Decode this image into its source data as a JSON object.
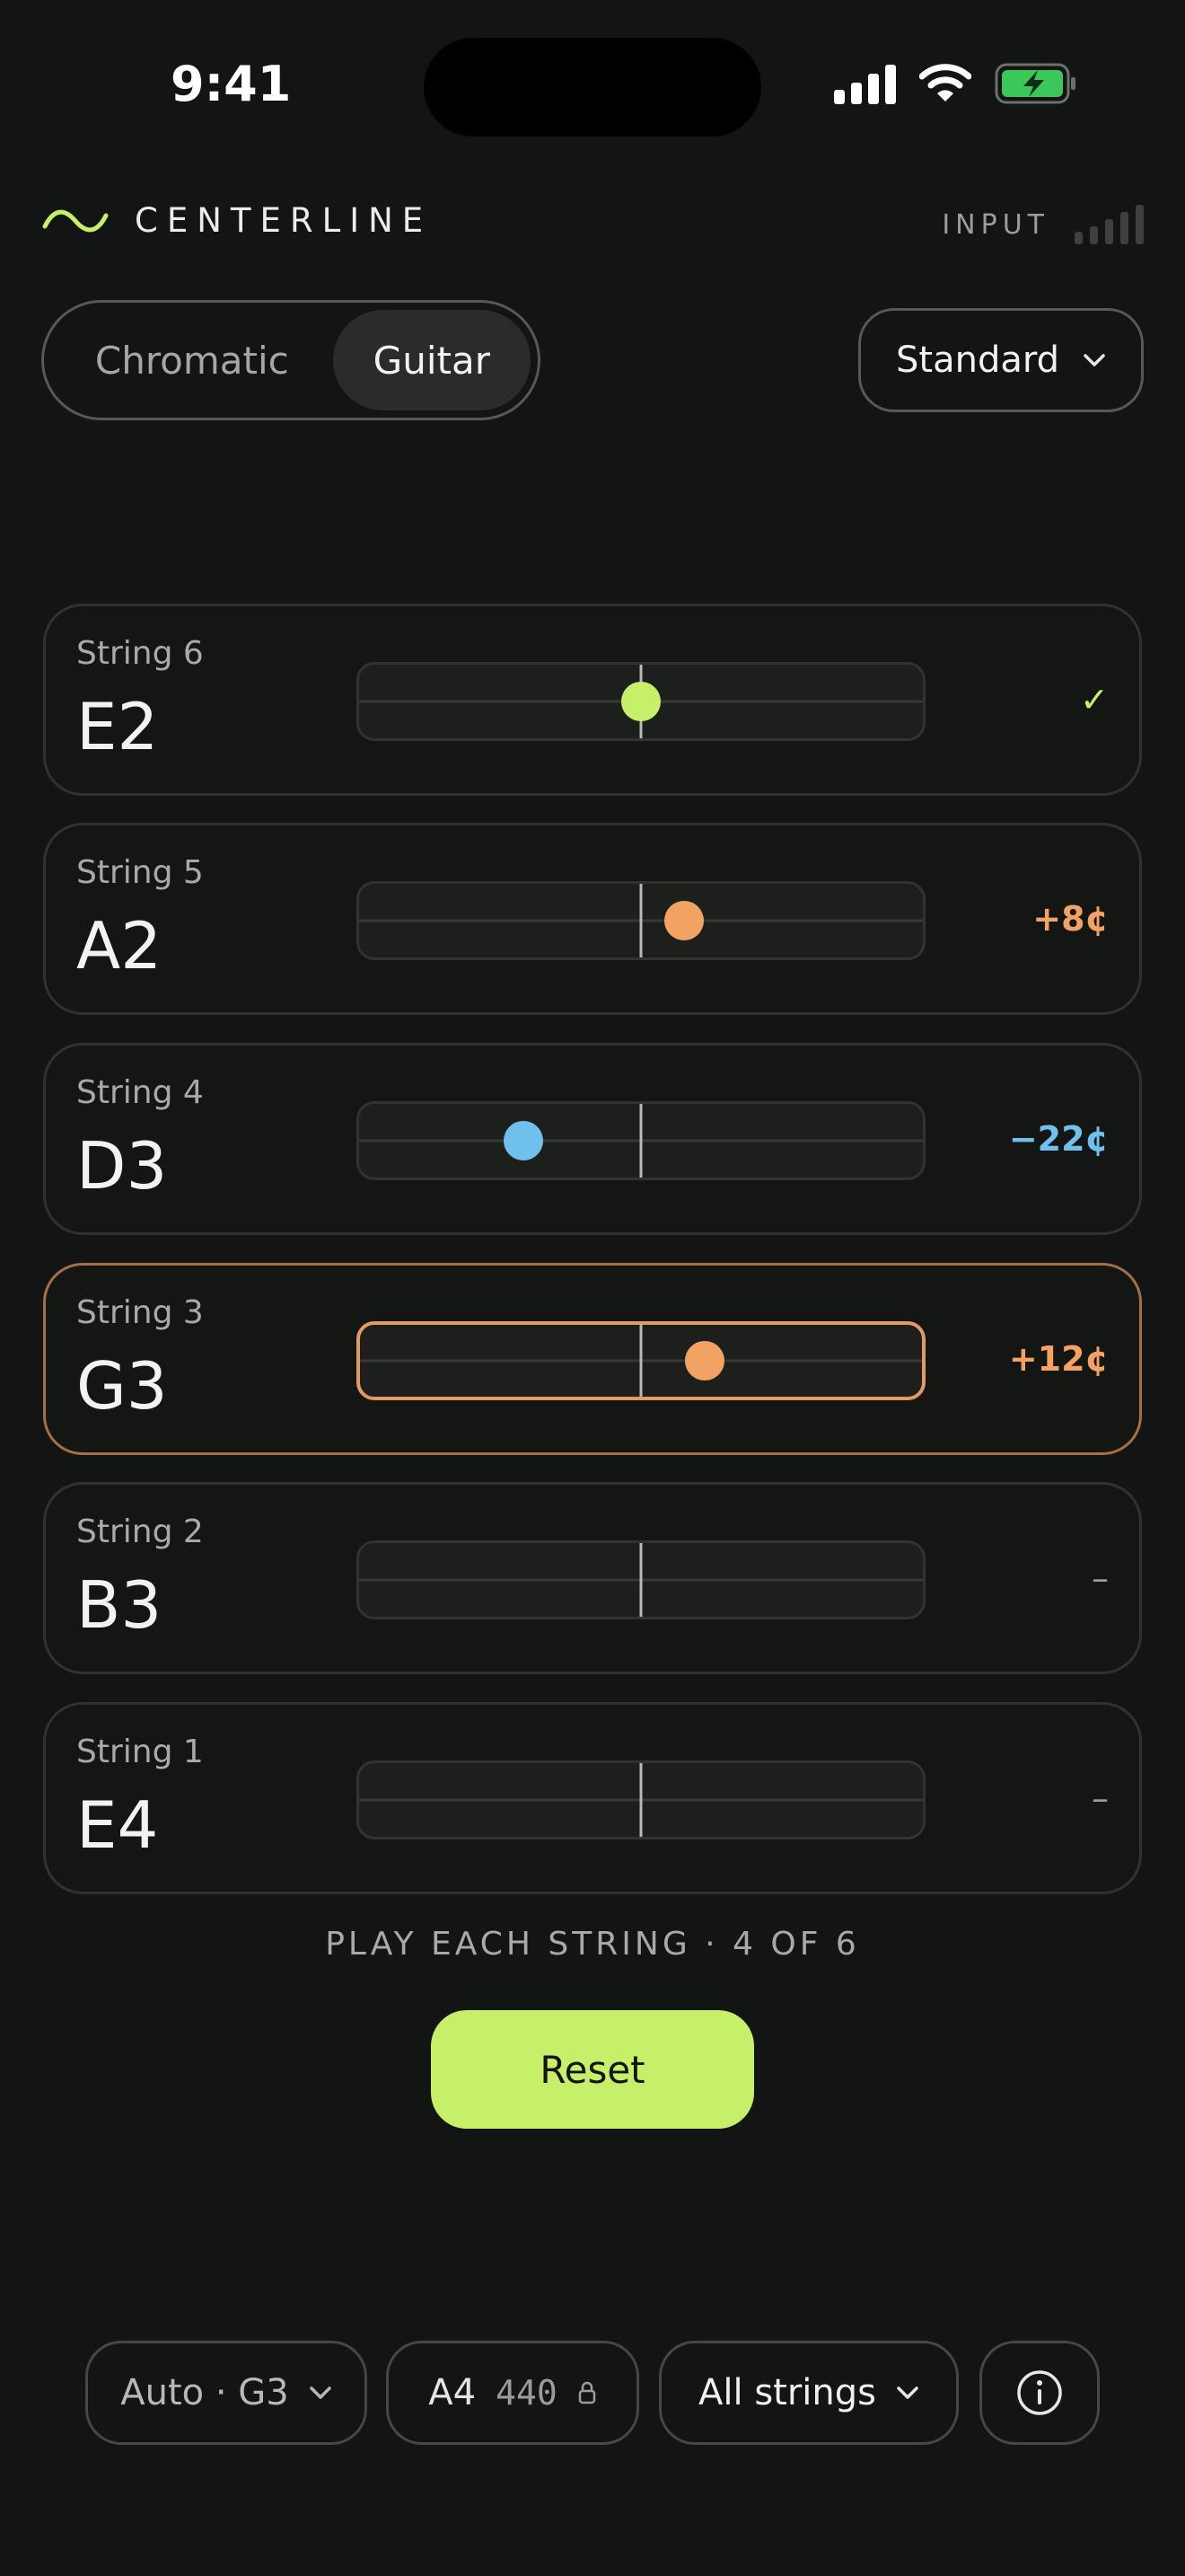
{
  "status_bar": {
    "time": "9:41"
  },
  "header": {
    "brand": "CENTERLINE",
    "input_label": "INPUT"
  },
  "mode": {
    "options": [
      "Chromatic",
      "Guitar"
    ],
    "selected": "Guitar"
  },
  "tuning": {
    "selected": "Standard"
  },
  "strings": [
    {
      "label": "String 6",
      "note": "E2",
      "readout": "✓",
      "cents": 0,
      "state": "in-tune",
      "color": "#C6F06A"
    },
    {
      "label": "String 5",
      "note": "A2",
      "readout": "+8¢",
      "cents": 8,
      "state": "sharp",
      "color": "#F2A263"
    },
    {
      "label": "String 4",
      "note": "D3",
      "readout": "−22¢",
      "cents": -22,
      "state": "flat",
      "color": "#6FC0EC"
    },
    {
      "label": "String 3",
      "note": "G3",
      "readout": "+12¢",
      "cents": 12,
      "state": "sharp-active",
      "color": "#F2A263"
    },
    {
      "label": "String 2",
      "note": "B3",
      "readout": "–",
      "cents": null,
      "state": "pending",
      "color": "#9C9D99"
    },
    {
      "label": "String 1",
      "note": "E4",
      "readout": "–",
      "cents": null,
      "state": "pending",
      "color": "#9C9D99"
    }
  ],
  "progress": {
    "hint": "PLAY EACH STRING · 4 OF 6"
  },
  "actions": {
    "reset_label": "Reset"
  },
  "toolbar": {
    "auto_label": "Auto · G3",
    "a4_label": "A4",
    "a4_value": "440",
    "strings_label": "All strings"
  },
  "colors": {
    "accent": "#C6F06A",
    "sharp": "#F2A263",
    "flat": "#6FC0EC",
    "background": "#131514"
  }
}
